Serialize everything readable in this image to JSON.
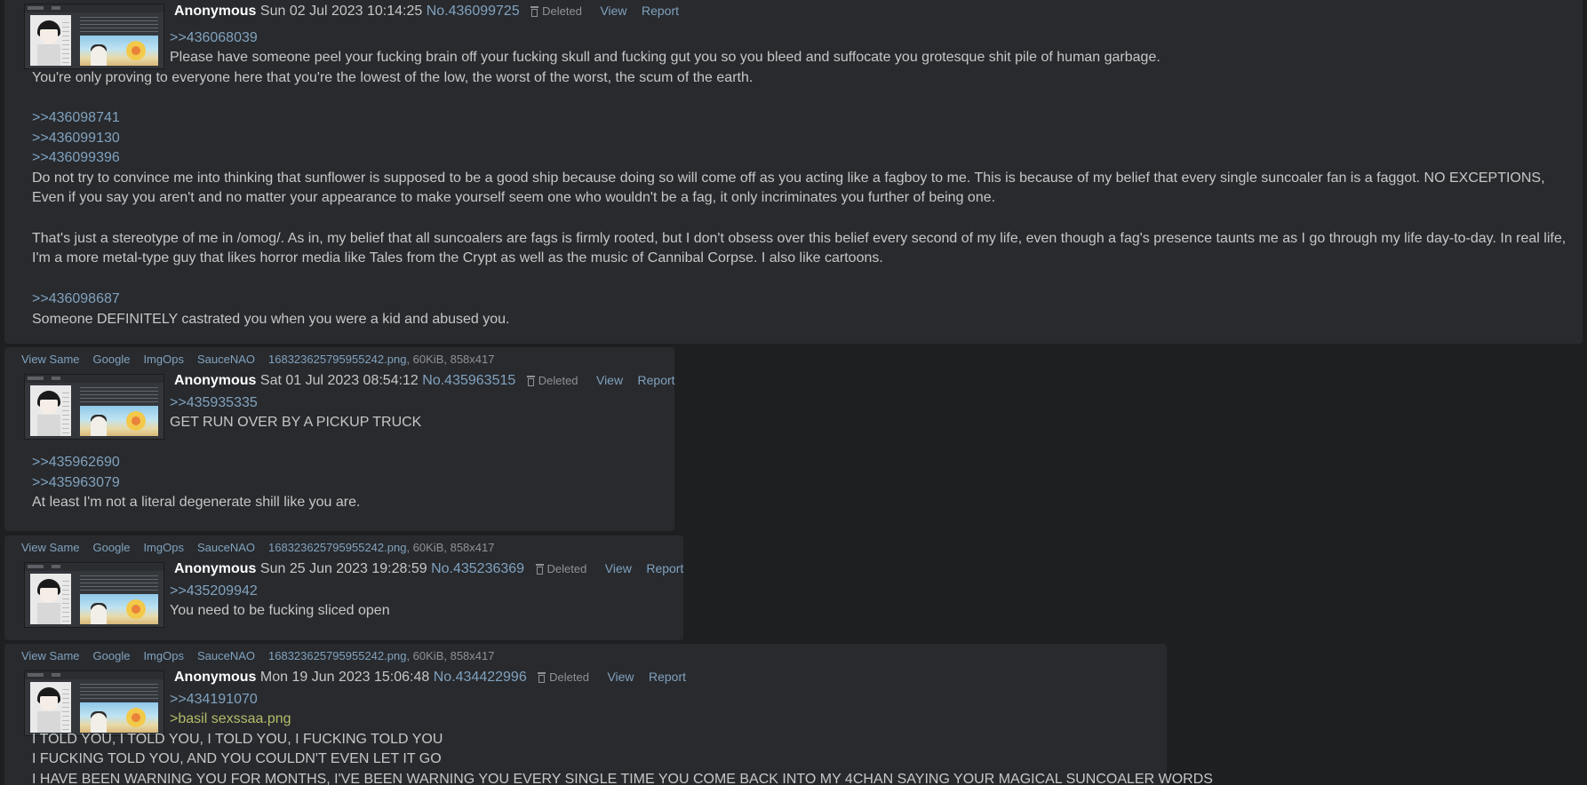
{
  "file_links": {
    "view_same": "View Same",
    "google": "Google",
    "imgops": "ImgOps",
    "saucenao": "SauceNAO"
  },
  "file": {
    "name": "168323625795955242.png",
    "meta": ", 60KiB, 858x417"
  },
  "labels": {
    "deleted": "Deleted",
    "view": "View",
    "report": "Report"
  },
  "posts": [
    {
      "name": "Anonymous",
      "date": "Sun 02 Jul 2023 10:14:25",
      "number": "No.436099725",
      "lines": [
        ">>436068039",
        "Please have someone peel your fucking brain off your fucking skull and fucking gut you so you bleed and suffocate you grotesque shit pile of human garbage.",
        "You're only proving to everyone here that you're the lowest of the low, the worst of the worst, the scum of the earth.",
        ">>436098741",
        ">>436099130",
        ">>436099396",
        "Do not try to convince me into thinking that sunflower is supposed to be a good ship because doing so will come off as you acting like a fagboy to me. This is because of my belief that every single suncoaler fan is a faggot. NO EXCEPTIONS, Even if you say you aren't and no matter your appearance to make yourself seem one who wouldn't be a fag, it only incriminates you further of being one.",
        "That's just a stereotype of me in /omog/. As in, my belief that all suncoalers are fags is firmly rooted, but I don't obsess over this belief every second of my life, even though a fag's presence taunts me as I go through my life day-to-day. In real life, I'm a more metal-type guy that likes horror media like Tales from the Crypt as well as the music of Cannibal Corpse. I also like cartoons.",
        ">>436098687",
        "Someone DEFINITELY castrated you when you were a kid and abused you."
      ]
    },
    {
      "name": "Anonymous",
      "date": "Sat 01 Jul 2023 08:54:12",
      "number": "No.435963515",
      "lines": [
        ">>435935335",
        "GET RUN OVER BY A PICKUP TRUCK",
        ">>435962690",
        ">>435963079",
        "At least I'm not a literal degenerate shill like you are."
      ]
    },
    {
      "name": "Anonymous",
      "date": "Sun 25 Jun 2023 19:28:59",
      "number": "No.435236369",
      "lines": [
        ">>435209942",
        "You need to be fucking sliced open"
      ]
    },
    {
      "name": "Anonymous",
      "date": "Mon 19 Jun 2023 15:06:48",
      "number": "No.434422996",
      "lines": [
        ">>434191070",
        ">basil sexssaa.png",
        "I TOLD YOU, I TOLD YOU, I TOLD YOU, I FUCKING TOLD YOU",
        "I FUCKING TOLD YOU, AND YOU COULDN'T EVEN LET IT GO",
        "I HAVE BEEN WARNING YOU FOR MONTHS, I'VE BEEN WARNING YOU EVERY SINGLE TIME YOU COME BACK INTO MY 4CHAN SAYING YOUR MAGICAL SUNCOALER WORDS"
      ]
    }
  ]
}
